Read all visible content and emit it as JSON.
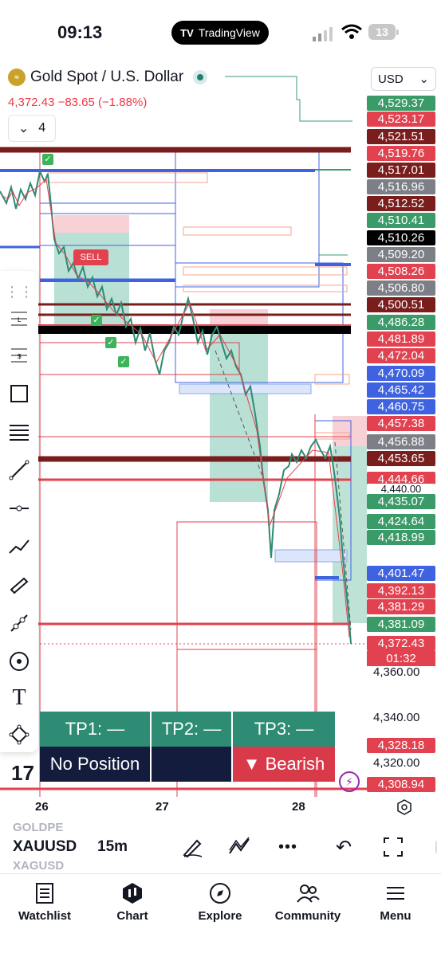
{
  "status": {
    "time": "09:13",
    "app_pill": "TradingView",
    "battery": "13"
  },
  "symbol": {
    "icon": "gold-coin-icon",
    "name": "Gold Spot / U.S. Dollar",
    "last": "4,372.43",
    "change": "−83.65",
    "change_pct": "(−1.88%)"
  },
  "collapse": {
    "count": "4"
  },
  "currency": {
    "value": "USD"
  },
  "price_labels": [
    {
      "text": "4,529.37",
      "color": "#3b9b68"
    },
    {
      "text": "4,523.17",
      "color": "#e2424f"
    },
    {
      "text": "4,521.51",
      "color": "#7a1d1d"
    },
    {
      "text": "4,519.76",
      "color": "#e2424f"
    },
    {
      "text": "4,517.01",
      "color": "#7a1d1d"
    },
    {
      "text": "4,516.96",
      "color": "#7d7f87"
    },
    {
      "text": "4,512.52",
      "color": "#7a1d1d"
    },
    {
      "text": "4,510.41",
      "color": "#3b9b68"
    },
    {
      "text": "4,510.26",
      "color": "#000000"
    },
    {
      "text": "4,509.20",
      "color": "#7d7f87"
    },
    {
      "text": "4,508.26",
      "color": "#e2424f"
    },
    {
      "text": "4,506.80",
      "color": "#7d7f87"
    },
    {
      "text": "4,500.51",
      "color": "#7a1d1d"
    },
    {
      "text": "4,486.28",
      "color": "#3b9b68"
    },
    {
      "text": "4,481.89",
      "color": "#e2424f"
    },
    {
      "text": "4,472.04",
      "color": "#e2424f"
    },
    {
      "text": "4,470.09",
      "color": "#3f63e0"
    },
    {
      "text": "4,465.42",
      "color": "#3f63e0"
    },
    {
      "text": "4,460.75",
      "color": "#3f63e0"
    },
    {
      "text": "4,457.38",
      "color": "#e2424f"
    },
    {
      "text": "4,456.88",
      "color": "#7d7f87"
    },
    {
      "text": "4,453.65",
      "color": "#7a1d1d"
    },
    {
      "text": "4,444.66",
      "color": "#e2424f"
    },
    {
      "text": "4,440.00",
      "color": "#ffffff"
    },
    {
      "text": "4,435.07",
      "color": "#3b9b68"
    },
    {
      "text": "4,424.64",
      "color": "#3b9b68"
    },
    {
      "text": "4,418.99",
      "color": "#3b9b68"
    },
    {
      "text": "4,401.47",
      "color": "#3f63e0"
    },
    {
      "text": "4,392.13",
      "color": "#e2424f"
    },
    {
      "text": "4,381.29",
      "color": "#e2424f"
    },
    {
      "text": "4,381.09",
      "color": "#3b9b68"
    },
    {
      "text": "4,372.43",
      "color": "#e2424f"
    },
    {
      "text": "4,328.18",
      "color": "#e2424f"
    },
    {
      "text": "4,308.94",
      "color": "#e2424f"
    }
  ],
  "countdown": "01:32",
  "axis_prices": [
    "4,360.00",
    "4,340.00",
    "4,320.00"
  ],
  "sell_label": "SELL",
  "tp": {
    "tp1": "TP1: —",
    "tp2": "TP2: —",
    "tp3": "TP3: —",
    "position": "No Position",
    "trend": "▼ Bearish"
  },
  "time_axis": [
    "26",
    "27",
    "28"
  ],
  "bottom": {
    "ghost1": "GOLDPE",
    "ticker": "XAUUSD",
    "ghost2": "XAGUSD",
    "interval": "15m"
  },
  "nav": [
    {
      "label": "Watchlist",
      "icon": "watchlist-icon"
    },
    {
      "label": "Chart",
      "icon": "chart-icon"
    },
    {
      "label": "Explore",
      "icon": "compass-icon"
    },
    {
      "label": "Community",
      "icon": "community-icon"
    },
    {
      "label": "Menu",
      "icon": "menu-icon"
    }
  ]
}
